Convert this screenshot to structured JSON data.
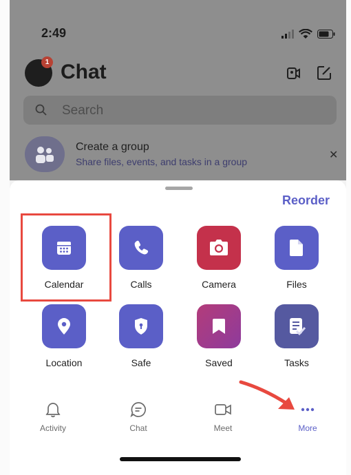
{
  "status": {
    "time": "2:49"
  },
  "header": {
    "title": "Chat",
    "badge": "1"
  },
  "search": {
    "placeholder": "Search"
  },
  "group_banner": {
    "title": "Create a group",
    "subtitle": "Share files, events, and tasks in a group"
  },
  "sheet": {
    "reorder_label": "Reorder",
    "apps": [
      {
        "label": "Calendar",
        "color": "#5b5fc7",
        "icon": "calendar-icon"
      },
      {
        "label": "Calls",
        "color": "#5b5fc7",
        "icon": "phone-icon"
      },
      {
        "label": "Camera",
        "color": "#c4314b",
        "icon": "camera-icon"
      },
      {
        "label": "Files",
        "color": "#5b5fc7",
        "icon": "file-icon"
      },
      {
        "label": "Location",
        "color": "#5b5fc7",
        "icon": "location-pin-icon"
      },
      {
        "label": "Safe",
        "color": "#5b5fc7",
        "icon": "shield-icon"
      },
      {
        "label": "Saved",
        "color": "#a83a8a",
        "icon": "bookmark-icon"
      },
      {
        "label": "Tasks",
        "color": "#5559a0",
        "icon": "tasks-icon"
      }
    ]
  },
  "tabs": [
    {
      "label": "Activity",
      "icon": "bell-icon"
    },
    {
      "label": "Chat",
      "icon": "chat-bubble-icon"
    },
    {
      "label": "Meet",
      "icon": "video-icon"
    },
    {
      "label": "More",
      "icon": "more-dots-icon",
      "active": true
    }
  ],
  "colors": {
    "accent": "#5b5fc7",
    "annotation": "#e8493f"
  }
}
